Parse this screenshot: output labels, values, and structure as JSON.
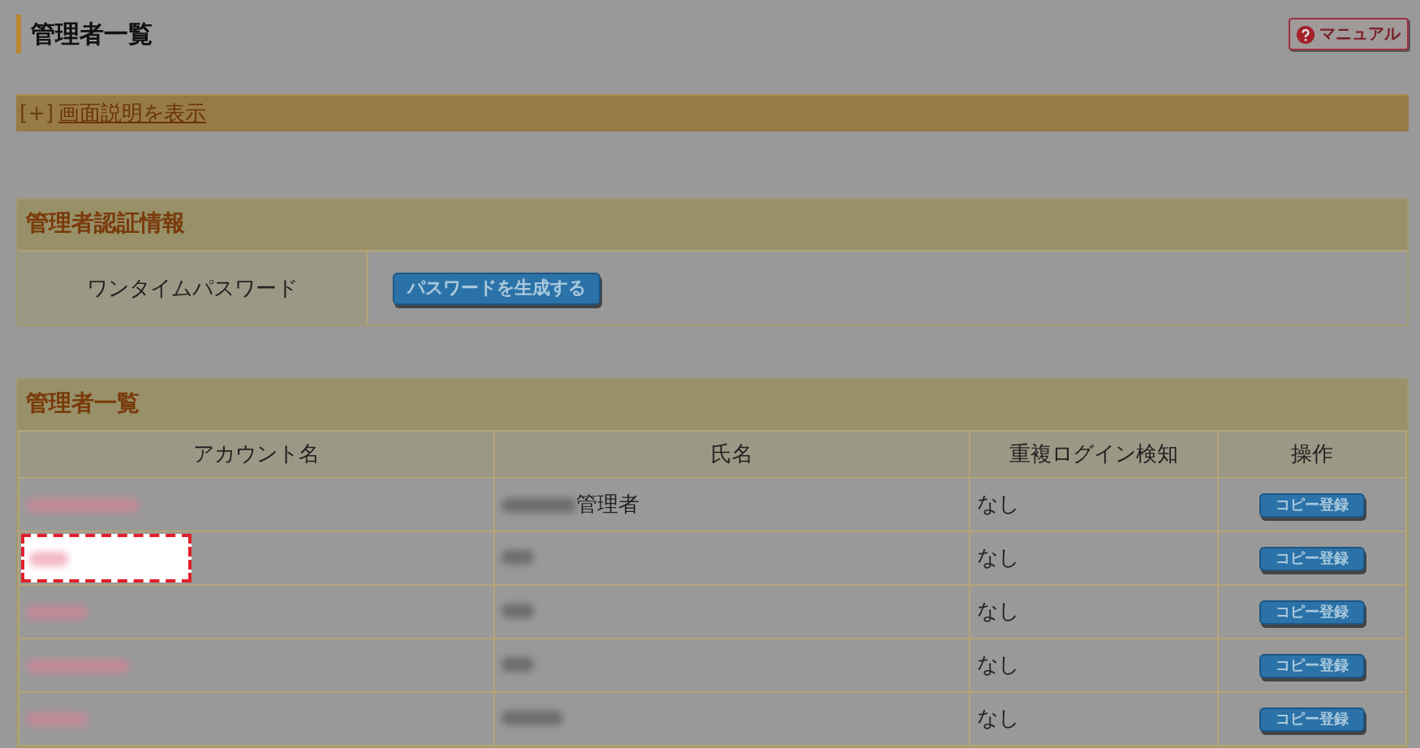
{
  "page": {
    "title": "管理者一覧",
    "manual_button": "マニュアル"
  },
  "help_bar": {
    "toggle": "[+]",
    "link": "画面説明を表示"
  },
  "auth_section": {
    "title": "管理者認証情報",
    "label": "ワンタイムパスワード",
    "button": "パスワードを生成する"
  },
  "admin_list": {
    "title": "管理者一覧",
    "columns": [
      "アカウント名",
      "氏名",
      "重複ログイン検知",
      "操作"
    ],
    "rows": [
      {
        "account_redacted": true,
        "name_redacted": true,
        "name": "管理者",
        "highlighted": false,
        "duplicate_login": "なし",
        "action": "コピー登録"
      },
      {
        "account_redacted": true,
        "name_redacted": true,
        "highlighted": true,
        "duplicate_login": "なし",
        "action": "コピー登録"
      },
      {
        "account_redacted": true,
        "name_redacted": true,
        "highlighted": false,
        "duplicate_login": "なし",
        "action": "コピー登録"
      },
      {
        "account_redacted": true,
        "name_redacted": true,
        "highlighted": false,
        "duplicate_login": "なし",
        "action": "コピー登録"
      },
      {
        "account_redacted": true,
        "name_redacted": true,
        "highlighted": false,
        "duplicate_login": "なし",
        "action": "コピー登録"
      }
    ]
  }
}
